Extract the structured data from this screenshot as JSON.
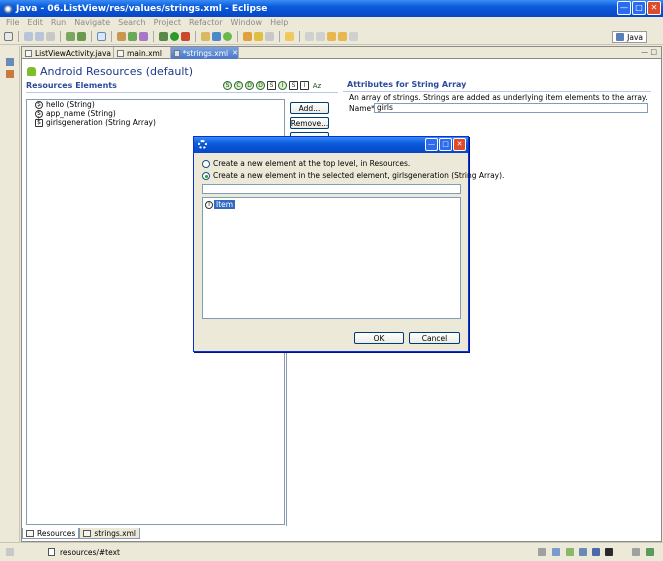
{
  "window": {
    "title": "Java - 06.ListView/res/values/strings.xml - Eclipse"
  },
  "menu": [
    "File",
    "Edit",
    "Run",
    "Navigate",
    "Search",
    "Project",
    "Refactor",
    "Window",
    "Help"
  ],
  "perspective": {
    "label": "Java"
  },
  "tabs": [
    {
      "label": "ListViewActivity.java"
    },
    {
      "label": "main.xml"
    },
    {
      "label": "*strings.xml"
    }
  ],
  "form": {
    "title": "Android Resources (default)",
    "resources_section": "Resources Elements",
    "attributes_section": "Attributes for String Array",
    "type_buttons": [
      "S",
      "C",
      "D",
      "D",
      "S",
      "I",
      "S",
      "I",
      "Az"
    ]
  },
  "tree": [
    {
      "icon": "S",
      "label": "hello (String)"
    },
    {
      "icon": "S",
      "label": "app_name (String)"
    },
    {
      "icon": "S",
      "label": "girlsgeneration (String Array)"
    }
  ],
  "buttons": {
    "add": "Add...",
    "remove": "Remove..."
  },
  "attributes": {
    "description": "An array of strings. Strings are added as underlying item elements to the array.",
    "name_label": "Name*",
    "name_value": "girls"
  },
  "bottom_tabs": [
    {
      "label": "Resources"
    },
    {
      "label": "strings.xml"
    }
  ],
  "status": {
    "text": "resources/#text"
  },
  "dialog": {
    "option_top": "Create a new element at the top level, in Resources.",
    "option_selected": "Create a new element in the selected element, girlsgeneration (String Array).",
    "filter_value": "",
    "list_items": [
      {
        "icon": "I",
        "label": "Item"
      }
    ],
    "ok": "OK",
    "cancel": "Cancel"
  },
  "colors": {
    "title_blue": "#0a5bdc",
    "section_blue": "#2a4b9b",
    "selection": "#316ac5"
  }
}
